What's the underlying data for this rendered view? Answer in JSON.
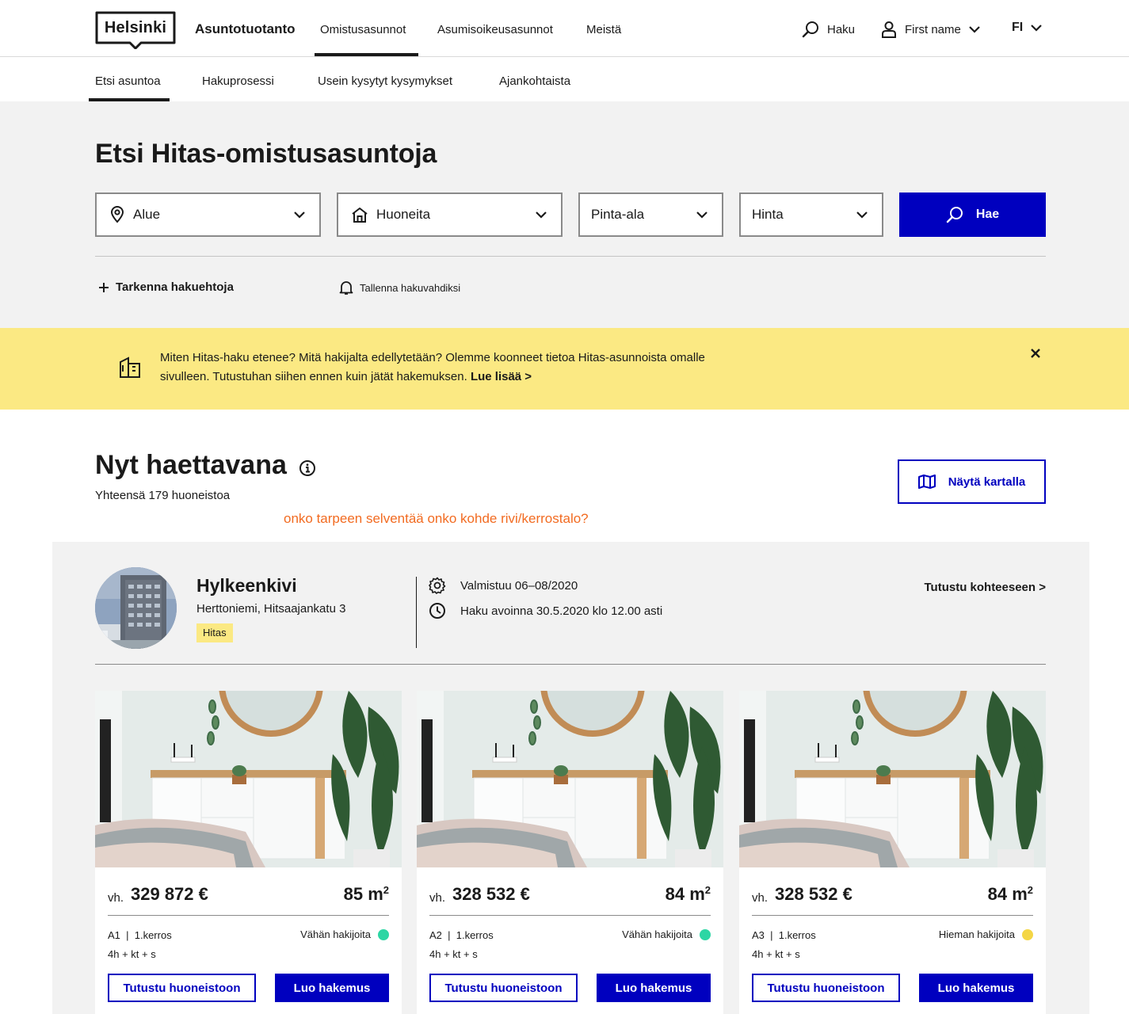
{
  "header": {
    "logo_text": "Helsinki",
    "site_name": "Asuntotuotanto",
    "nav": [
      "Omistusasunnot",
      "Asumisoikeusasunnot",
      "Meistä"
    ],
    "search_label": "Haku",
    "user_label": "First name",
    "language": "FI"
  },
  "subnav": [
    "Etsi asuntoa",
    "Hakuprosessi",
    "Usein kysytyt kysymykset",
    "Ajankohtaista"
  ],
  "search": {
    "title": "Etsi Hitas-omistusasuntoja",
    "fields": [
      "Alue",
      "Huoneita",
      "Pinta-ala",
      "Hinta"
    ],
    "button": "Hae",
    "refine": "Tarkenna hakuehtoja",
    "save": "Tallenna hakuvahdiksi"
  },
  "notice": {
    "text": "Miten Hitas-haku etenee? Mitä hakijalta edellytetään? Olemme koonneet tietoa Hitas-asunnoista omalle sivulleen. Tutustuhan siihen ennen kuin jätät hakemuksen.",
    "link": "Lue lisää >"
  },
  "results": {
    "title": "Nyt haettavana",
    "count": "Yhteensä 179 huoneistoa",
    "note": "onko tarpeen selventää onko kohde rivi/kerrostalo?",
    "map_button": "Näytä kartalla"
  },
  "project": {
    "name": "Hylkeenkivi",
    "address": "Herttoniemi, Hitsaajankatu 3",
    "tag": "Hitas",
    "completion": "Valmistuu 06–08/2020",
    "application": "Haku avoinna 30.5.2020 klo 12.00 asti",
    "link": "Tutustu kohteeseen >"
  },
  "apartments": [
    {
      "price_prefix": "vh.",
      "price": "329 872 €",
      "area": "85 m",
      "area_unit_sup": "2",
      "number": "A1",
      "floor": "1.kerros",
      "rooms": "4h + kt + s",
      "demand": "Vähän hakijoita",
      "demand_color": "#2dd6a4",
      "explore": "Tutustu huoneistoon",
      "apply": "Luo hakemus"
    },
    {
      "price_prefix": "vh.",
      "price": "328 532 €",
      "area": "84 m",
      "area_unit_sup": "2",
      "number": "A2",
      "floor": "1.kerros",
      "rooms": "4h + kt + s",
      "demand": "Vähän hakijoita",
      "demand_color": "#2dd6a4",
      "explore": "Tutustu huoneistoon",
      "apply": "Luo hakemus"
    },
    {
      "price_prefix": "vh.",
      "price": "328 532 €",
      "area": "84 m",
      "area_unit_sup": "2",
      "number": "A3",
      "floor": "1.kerros",
      "rooms": "4h + kt + s",
      "demand": "Hieman hakijoita",
      "demand_color": "#f4d646",
      "explore": "Tutustu huoneistoon",
      "apply": "Luo hakemus"
    }
  ],
  "colors": {
    "brand_blue": "#0000bf",
    "notice_yellow": "#fbe983",
    "note_orange": "#f26b21",
    "panel_grey": "#f2f2f2"
  }
}
